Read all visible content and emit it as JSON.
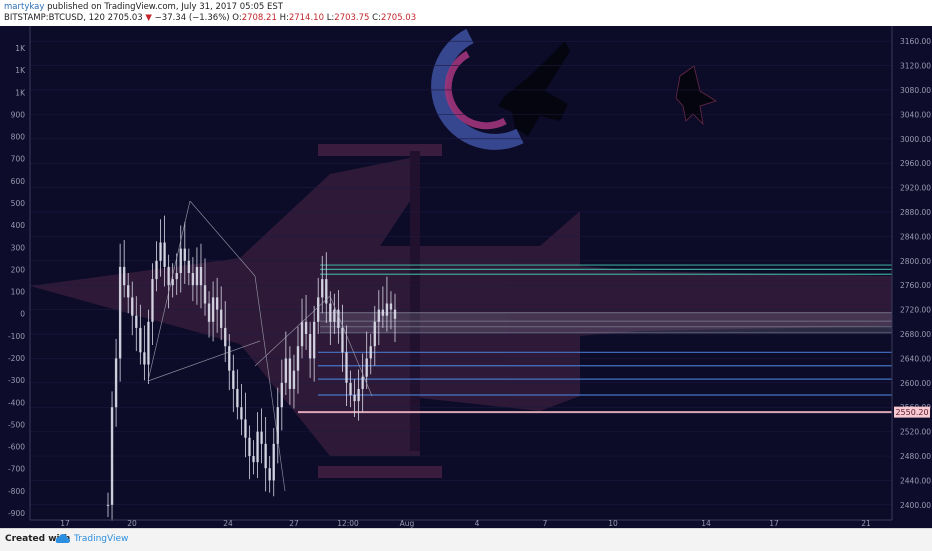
{
  "header": {
    "author": "martykay",
    "published_text": "published on TradingView.com, July 31, 2017 05:05 EST",
    "symbol": "BITSTAMP:BTCUSD, 120",
    "last": "2705.03",
    "change": "−37.34 (−1.36%)",
    "o_label": "O:",
    "o_val": "2708.21",
    "h_label": "H:",
    "h_val": "2714.10",
    "l_label": "L:",
    "l_val": "2703.75",
    "c_label": "C:",
    "c_val": "2705.03"
  },
  "footer": {
    "created_with": "Created with",
    "brand": "TradingView"
  },
  "colors": {
    "background": "#0d0c2b",
    "candle": "#d8d8e6",
    "plane_body": "#3a1f3e",
    "plane_dark": "#050510",
    "arc_blue": "#3b4c9a",
    "arc_pink": "#a0347a",
    "level_teal": "#3fb3a0",
    "level_blue": "#4a7fd6",
    "level_pink": "#f2b8c6",
    "price_label_bg": "#f7c9d3"
  },
  "chart_data": {
    "type": "line",
    "title": "",
    "left_axis_ticks": [
      "1K",
      "1K",
      "1K",
      "900",
      "800",
      "700",
      "600",
      "500",
      "400",
      "300",
      "200",
      "100",
      "0",
      "-100",
      "-200",
      "-300",
      "-400",
      "-500",
      "-600",
      "-700",
      "-800",
      "-900"
    ],
    "right_axis_ticks": [
      "3160.00",
      "3120.00",
      "3080.00",
      "3040.00",
      "3000.00",
      "2960.00",
      "2920.00",
      "2880.00",
      "2840.00",
      "2800.00",
      "2760.00",
      "2720.00",
      "2680.00",
      "2640.00",
      "2600.00",
      "2560.00",
      "2520.00",
      "2480.00",
      "2440.00",
      "2400.00"
    ],
    "x_ticks": [
      "17",
      "20",
      "24",
      "27",
      "12:00",
      "Aug",
      "4",
      "7",
      "10",
      "14",
      "17",
      "21"
    ],
    "ylim": [
      2385,
      3175
    ],
    "last_price_label": "2550.20",
    "levels": [
      {
        "price": 2793,
        "color": "teal"
      },
      {
        "price": 2786,
        "color": "teal"
      },
      {
        "price": 2778,
        "color": "teal"
      },
      {
        "price": 2715,
        "color": "gray"
      },
      {
        "price": 2701,
        "color": "gray"
      },
      {
        "price": 2692,
        "color": "gray"
      },
      {
        "price": 2682,
        "color": "gray"
      },
      {
        "price": 2650,
        "color": "blue"
      },
      {
        "price": 2628,
        "color": "blue"
      },
      {
        "price": 2606,
        "color": "blue"
      },
      {
        "price": 2580,
        "color": "blue"
      },
      {
        "price": 2552,
        "color": "pink"
      }
    ],
    "series": [
      {
        "x": [
          0,
          2,
          4,
          6,
          8,
          10,
          12,
          14,
          16,
          18,
          20,
          22,
          24,
          26,
          28,
          30,
          32,
          34,
          36,
          38,
          40,
          42,
          44,
          46,
          48,
          50,
          52,
          54,
          56,
          58,
          60,
          62,
          64,
          66,
          68,
          70,
          72,
          74,
          76,
          78,
          80,
          82,
          84,
          86,
          88,
          90,
          92,
          94,
          96,
          98,
          100,
          102,
          104,
          106,
          108,
          110,
          112,
          114,
          116,
          118,
          120,
          122,
          124,
          126,
          128,
          130,
          132,
          134,
          136,
          138,
          140,
          142
        ],
        "close": [
          2400,
          2560,
          2640,
          2790,
          2760,
          2740,
          2710,
          2690,
          2650,
          2630,
          2700,
          2770,
          2800,
          2830,
          2790,
          2760,
          2770,
          2780,
          2820,
          2800,
          2780,
          2760,
          2790,
          2760,
          2730,
          2700,
          2740,
          2720,
          2690,
          2660,
          2620,
          2590,
          2560,
          2540,
          2510,
          2480,
          2470,
          2520,
          2500,
          2460,
          2440,
          2500,
          2560,
          2600,
          2640,
          2590,
          2620,
          2660,
          2700,
          2680,
          2640,
          2700,
          2740,
          2770,
          2730,
          2700,
          2720,
          2690,
          2650,
          2600,
          2580,
          2570,
          2590,
          2610,
          2640,
          2660,
          2700,
          2720,
          2710,
          2730,
          2720,
          2705
        ]
      }
    ]
  }
}
